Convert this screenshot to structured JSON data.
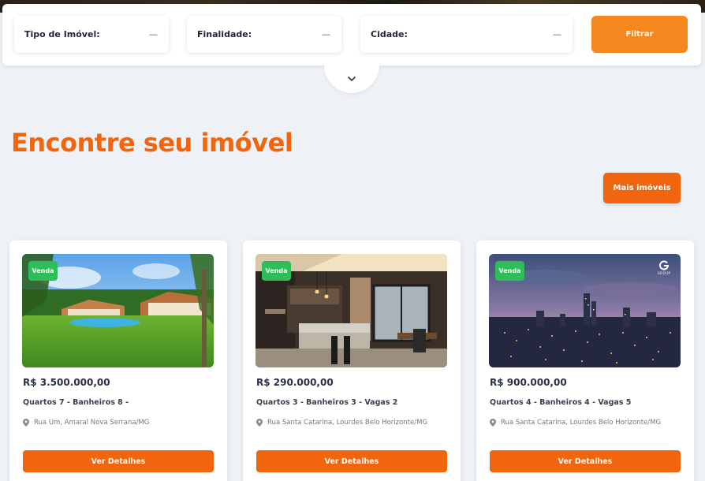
{
  "filters": {
    "property_type": {
      "label": "Tipo de Imóvel:",
      "value": "—"
    },
    "purpose": {
      "label": "Finalidade:",
      "value": "—"
    },
    "city": {
      "label": "Cidade:",
      "value": "—"
    },
    "submit_label": "Filtrar"
  },
  "section": {
    "title": "Encontre seu imóvel",
    "more_label": "Mais imóveis"
  },
  "listings": [
    {
      "badge": "Venda",
      "price": "R$ 3.500.000,00",
      "features": "Quartos 7 - Banheiros 8 -",
      "address": "Rua Um, Amaral Nova Serrana/MG",
      "button": "Ver Detalhes",
      "photo": "country-house-with-pool"
    },
    {
      "badge": "Venda",
      "price": "R$ 290.000,00",
      "features": "Quartos 3 - Banheiros 3 - Vagas 2",
      "address": "Rua Santa Catarina, Lourdes Belo Horizonte/MG",
      "button": "Ver Detalhes",
      "photo": "modern-kitchen-interior"
    },
    {
      "badge": "Venda",
      "price": "R$ 900.000,00",
      "features": "Quartos 4 - Banheiros 4 - Vagas 5",
      "address": "Rua Santa Catarina, Lourdes Belo Horizonte/MG",
      "button": "Ver Detalhes",
      "photo": "city-skyline-dusk",
      "watermark": "GROUP"
    }
  ],
  "colors": {
    "accent": "#f0650e",
    "filter_button": "#f5871f",
    "badge": "#2ebd59",
    "background": "#eef1f5"
  }
}
